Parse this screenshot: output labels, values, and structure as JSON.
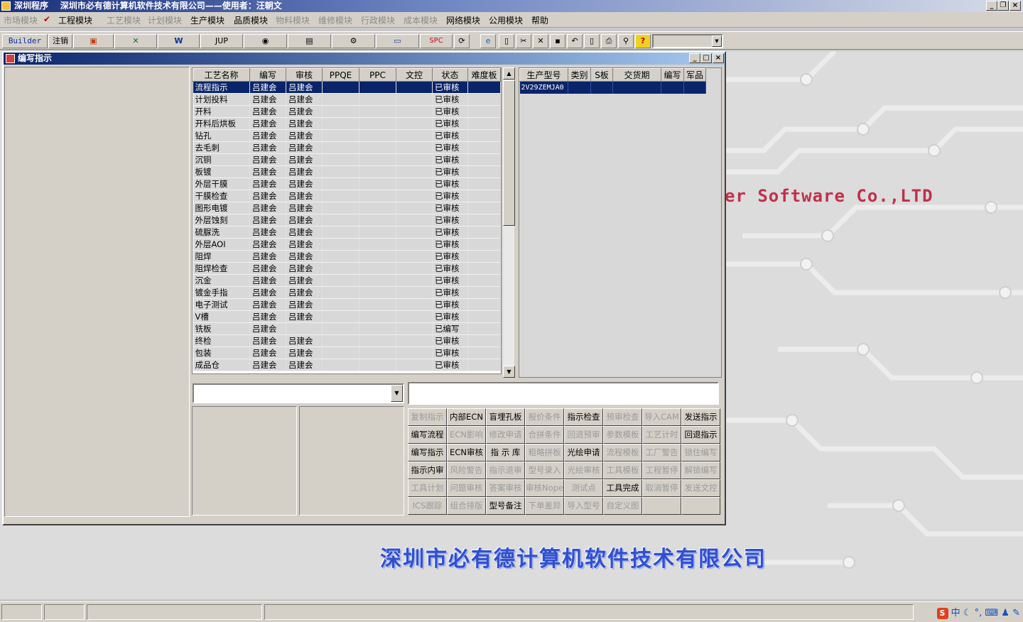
{
  "app_title": "深圳程序    深圳市必有德计算机软件技术有限公司——使用者：汪朝文",
  "menus": [
    {
      "label": "市场模块",
      "enabled": false
    },
    {
      "label": "工程模块",
      "enabled": true,
      "checked": true
    },
    {
      "label": "工艺模块",
      "enabled": false
    },
    {
      "label": "计划模块",
      "enabled": false
    },
    {
      "label": "生产模块",
      "enabled": true
    },
    {
      "label": "品质模块",
      "enabled": true
    },
    {
      "label": "物料模块",
      "enabled": false
    },
    {
      "label": "维修模块",
      "enabled": false
    },
    {
      "label": "行政模块",
      "enabled": false
    },
    {
      "label": "成本模块",
      "enabled": false
    },
    {
      "label": "网络模块",
      "enabled": true
    },
    {
      "label": "公用模块",
      "enabled": true
    },
    {
      "label": "帮助",
      "enabled": true
    }
  ],
  "toolbar": {
    "builder": "Builder",
    "logout": "注销",
    "jup": "JUP",
    "spc": "SPC",
    "help": "?"
  },
  "window_title": "编写指示",
  "brand_english": "er Software Co.,LTD",
  "brand_chinese": "深圳市必有德计算机软件技术有限公司",
  "process_table": {
    "columns": [
      "工艺名称",
      "编写",
      "审核",
      "PPQE",
      "PPC",
      "文控",
      "状态",
      "难度板"
    ],
    "rows": [
      [
        "流程指示",
        "吕建会",
        "吕建会",
        "",
        "",
        "",
        "已审核",
        ""
      ],
      [
        "计划投料",
        "吕建会",
        "吕建会",
        "",
        "",
        "",
        "已审核",
        ""
      ],
      [
        "开料",
        "吕建会",
        "吕建会",
        "",
        "",
        "",
        "已审核",
        ""
      ],
      [
        "开料后烘板",
        "吕建会",
        "吕建会",
        "",
        "",
        "",
        "已审核",
        ""
      ],
      [
        "钻孔",
        "吕建会",
        "吕建会",
        "",
        "",
        "",
        "已审核",
        ""
      ],
      [
        "去毛刺",
        "吕建会",
        "吕建会",
        "",
        "",
        "",
        "已审核",
        ""
      ],
      [
        "沉铜",
        "吕建会",
        "吕建会",
        "",
        "",
        "",
        "已审核",
        ""
      ],
      [
        "板镀",
        "吕建会",
        "吕建会",
        "",
        "",
        "",
        "已审核",
        ""
      ],
      [
        "外层干膜",
        "吕建会",
        "吕建会",
        "",
        "",
        "",
        "已审核",
        ""
      ],
      [
        "干膜检查",
        "吕建会",
        "吕建会",
        "",
        "",
        "",
        "已审核",
        ""
      ],
      [
        "图形电镀",
        "吕建会",
        "吕建会",
        "",
        "",
        "",
        "已审核",
        ""
      ],
      [
        "外层蚀刻",
        "吕建会",
        "吕建会",
        "",
        "",
        "",
        "已审核",
        ""
      ],
      [
        "硫脲洗",
        "吕建会",
        "吕建会",
        "",
        "",
        "",
        "已审核",
        ""
      ],
      [
        "外层AOI",
        "吕建会",
        "吕建会",
        "",
        "",
        "",
        "已审核",
        ""
      ],
      [
        "阻焊",
        "吕建会",
        "吕建会",
        "",
        "",
        "",
        "已审核",
        ""
      ],
      [
        "阻焊检查",
        "吕建会",
        "吕建会",
        "",
        "",
        "",
        "已审核",
        ""
      ],
      [
        "沉金",
        "吕建会",
        "吕建会",
        "",
        "",
        "",
        "已审核",
        ""
      ],
      [
        "镀金手指",
        "吕建会",
        "吕建会",
        "",
        "",
        "",
        "已审核",
        ""
      ],
      [
        "电子测试",
        "吕建会",
        "吕建会",
        "",
        "",
        "",
        "已审核",
        ""
      ],
      [
        "V槽",
        "吕建会",
        "吕建会",
        "",
        "",
        "",
        "已审核",
        ""
      ],
      [
        "铣板",
        "吕建会",
        "",
        "",
        "",
        "",
        "已编写",
        ""
      ],
      [
        "终检",
        "吕建会",
        "吕建会",
        "",
        "",
        "",
        "已审核",
        ""
      ],
      [
        "包装",
        "吕建会",
        "吕建会",
        "",
        "",
        "",
        "已审核",
        ""
      ],
      [
        "成品仓",
        "吕建会",
        "吕建会",
        "",
        "",
        "",
        "已审核",
        ""
      ]
    ]
  },
  "model_table": {
    "columns": [
      "生产型号",
      "类别",
      "S板",
      "交货期",
      "编写",
      "军品"
    ],
    "rows": [
      [
        "2V29ZEMJA0",
        "",
        "",
        "",
        "",
        ""
      ]
    ]
  },
  "action_buttons": [
    {
      "label": "复制指示",
      "enabled": false
    },
    {
      "label": "内部ECN",
      "enabled": true
    },
    {
      "label": "盲埋孔板",
      "enabled": true
    },
    {
      "label": "报价条件",
      "enabled": false
    },
    {
      "label": "指示检查",
      "enabled": true
    },
    {
      "label": "预审检查",
      "enabled": false
    },
    {
      "label": "导入CAM",
      "enabled": false
    },
    {
      "label": "发送指示",
      "enabled": true
    },
    {
      "label": "编写流程",
      "enabled": true
    },
    {
      "label": "ECN影响",
      "enabled": false
    },
    {
      "label": "修改申请",
      "enabled": false
    },
    {
      "label": "合拼条件",
      "enabled": false
    },
    {
      "label": "回退预审",
      "enabled": false
    },
    {
      "label": "参数模板",
      "enabled": false
    },
    {
      "label": "工艺计时",
      "enabled": false
    },
    {
      "label": "回退指示",
      "enabled": true
    },
    {
      "label": "编写指示",
      "enabled": true
    },
    {
      "label": "ECN审核",
      "enabled": true
    },
    {
      "label": "指 示 库",
      "enabled": true
    },
    {
      "label": "粗略拼板",
      "enabled": false
    },
    {
      "label": "光绘申请",
      "enabled": true
    },
    {
      "label": "流程模板",
      "enabled": false
    },
    {
      "label": "工厂警告",
      "enabled": false
    },
    {
      "label": "锁住编写",
      "enabled": false
    },
    {
      "label": "指示内审",
      "enabled": true
    },
    {
      "label": "风险警告",
      "enabled": false
    },
    {
      "label": "指示退审",
      "enabled": false
    },
    {
      "label": "型号录入",
      "enabled": false
    },
    {
      "label": "光绘审核",
      "enabled": false
    },
    {
      "label": "工具模板",
      "enabled": false
    },
    {
      "label": "工程暂停",
      "enabled": false
    },
    {
      "label": "解锁编写",
      "enabled": false
    },
    {
      "label": "工具计划",
      "enabled": false
    },
    {
      "label": "问题审核",
      "enabled": false
    },
    {
      "label": "答案审核",
      "enabled": false
    },
    {
      "label": "审核Nope",
      "enabled": false
    },
    {
      "label": "测试点",
      "enabled": false
    },
    {
      "label": "工具完成",
      "enabled": true
    },
    {
      "label": "取消暂停",
      "enabled": false
    },
    {
      "label": "发送文控",
      "enabled": false
    },
    {
      "label": "ICS跟踪",
      "enabled": false
    },
    {
      "label": "组合排版",
      "enabled": false
    },
    {
      "label": "型号备注",
      "enabled": true
    },
    {
      "label": "下单差异",
      "enabled": false
    },
    {
      "label": "导入型号",
      "enabled": false
    },
    {
      "label": "自定义图",
      "enabled": false
    },
    {
      "label": "",
      "enabled": false
    },
    {
      "label": "",
      "enabled": false
    }
  ],
  "ime": "中"
}
